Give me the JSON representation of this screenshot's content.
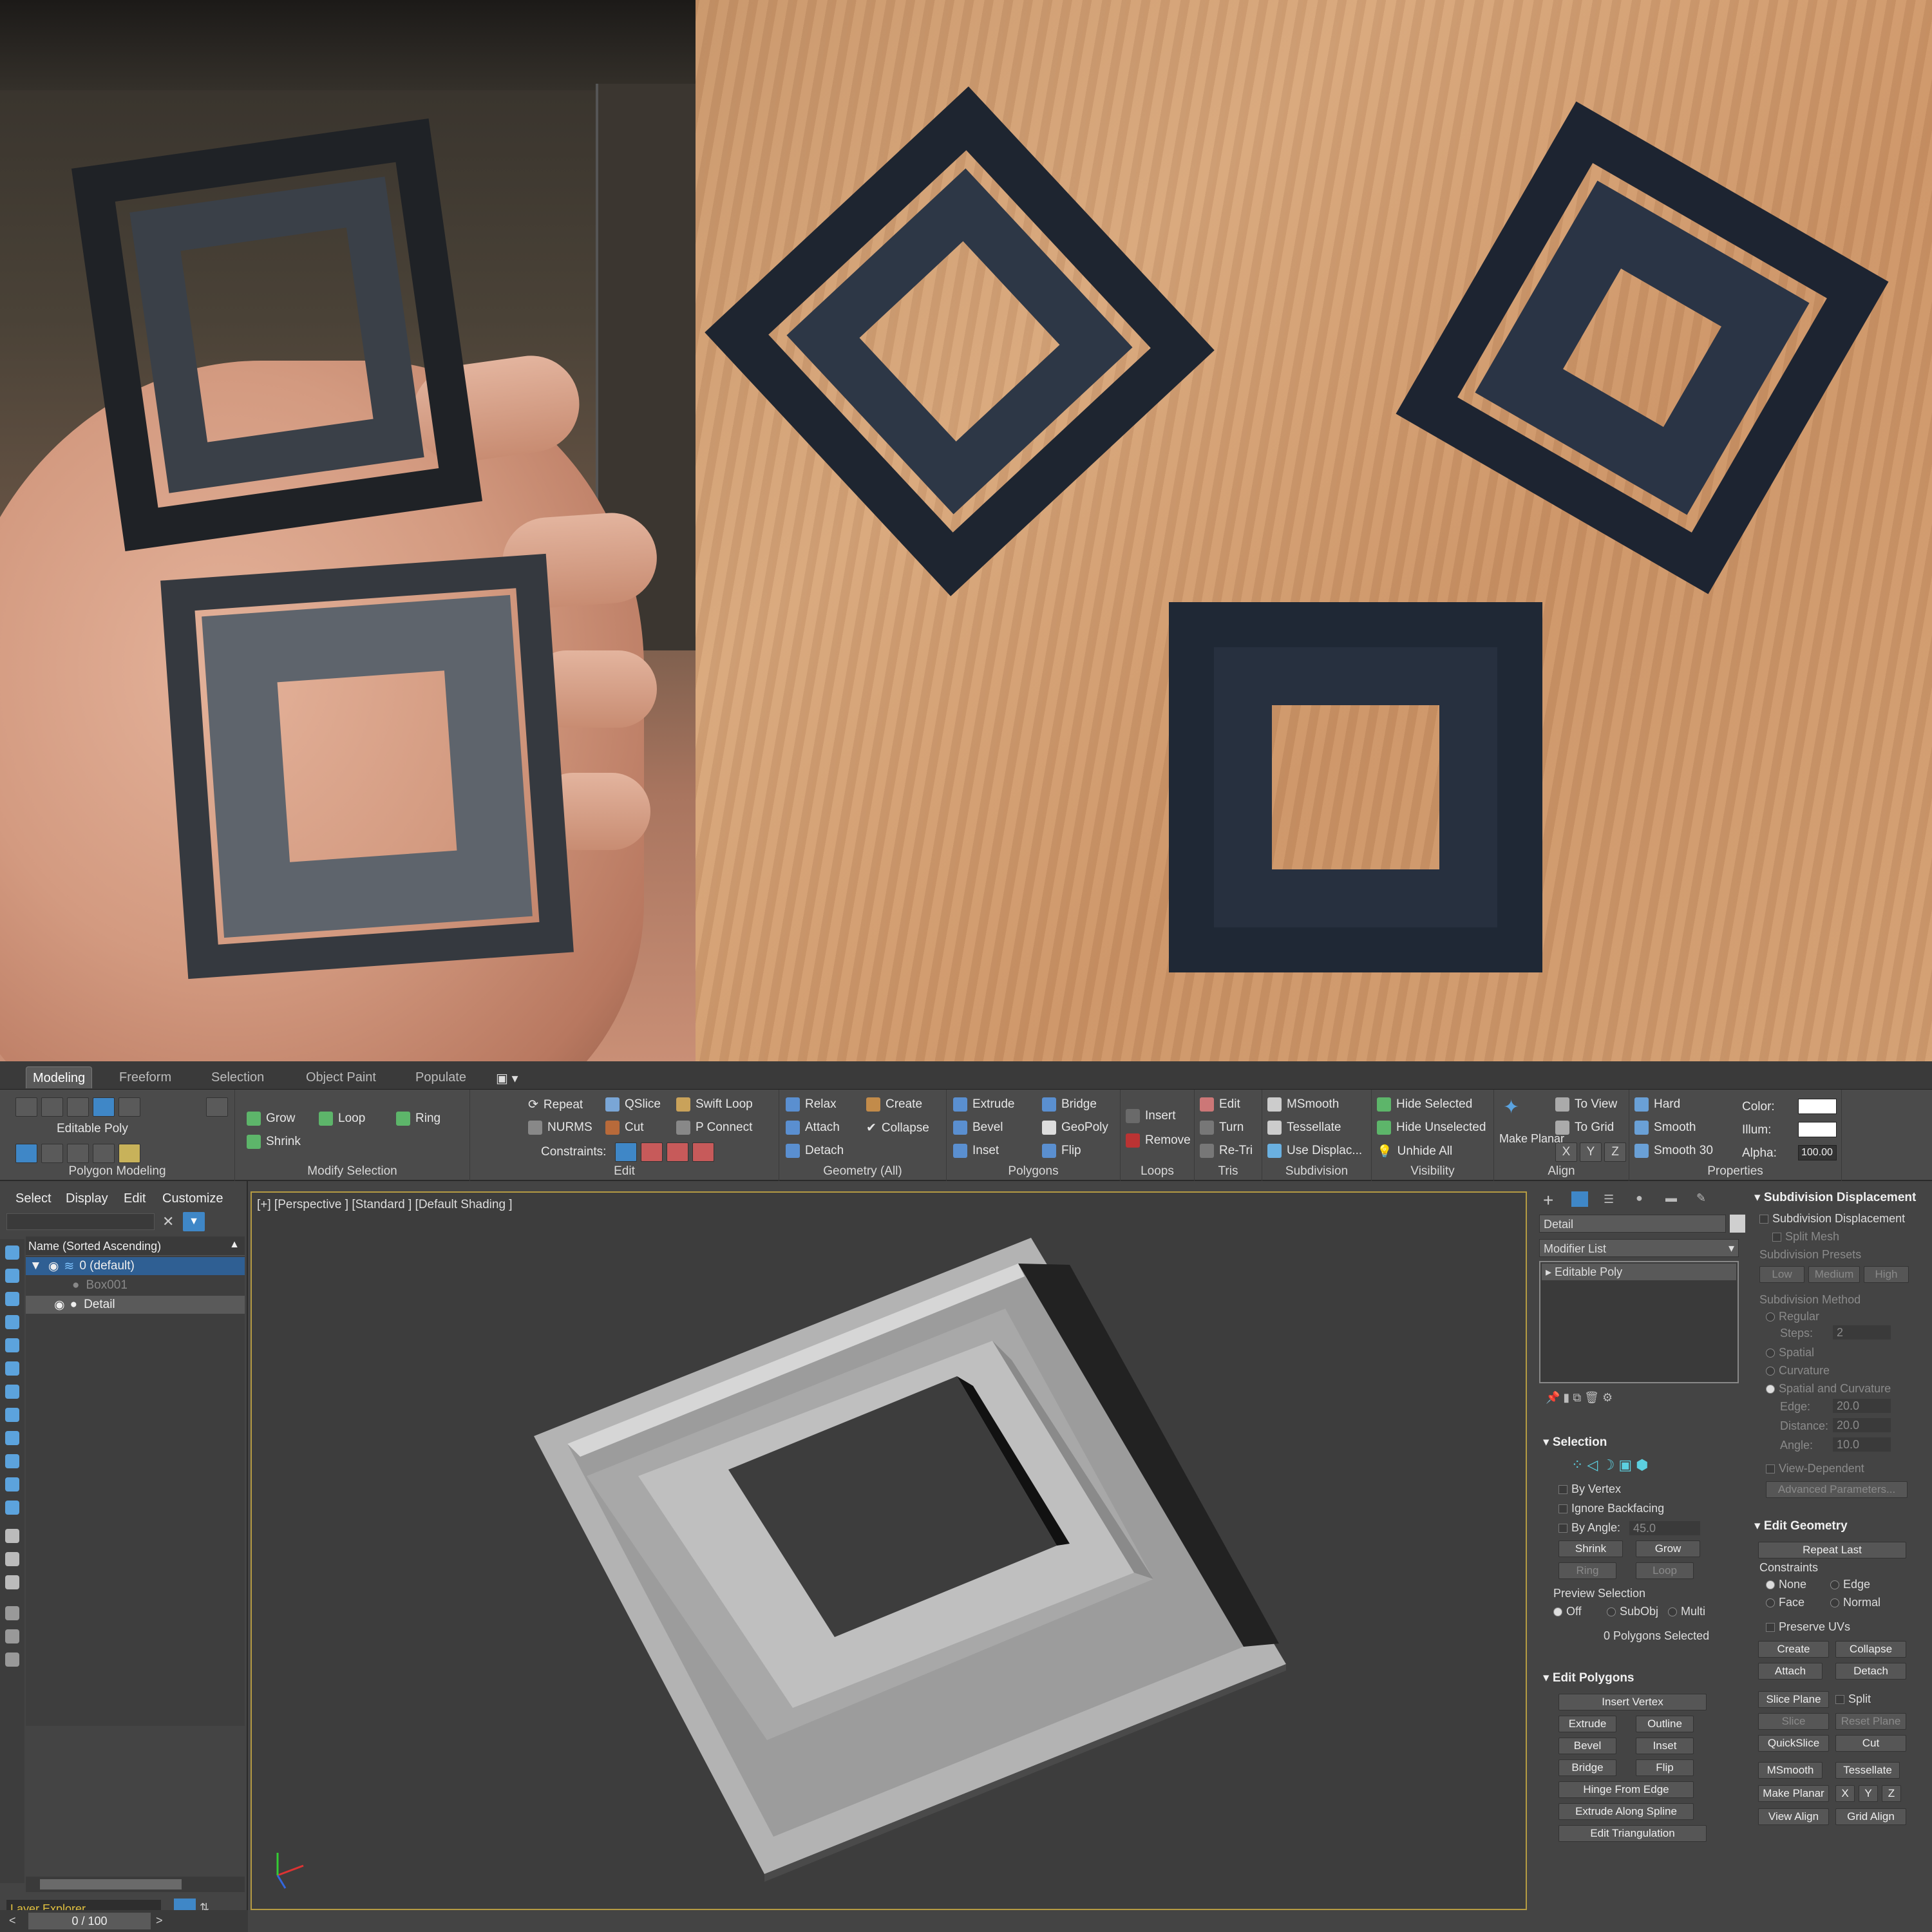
{
  "photo_left": {
    "caption": ""
  },
  "ribbon": {
    "tabs": [
      "Modeling",
      "Freeform",
      "Selection",
      "Object Paint",
      "Populate"
    ],
    "active_tab": "Modeling",
    "groups": {
      "polygon_modeling": {
        "label": "Polygon Modeling",
        "object": "Editable Poly"
      },
      "modify_selection": {
        "label": "Modify Selection",
        "grow": "Grow",
        "shrink": "Shrink",
        "loop": "Loop",
        "ring": "Ring"
      },
      "edit": {
        "label": "Edit",
        "repeat": "Repeat",
        "qslice": "QSlice",
        "swift_loop": "Swift Loop",
        "nurms": "NURMS",
        "cut": "Cut",
        "p_connect": "P Connect",
        "constraints": "Constraints:"
      },
      "geometry": {
        "label": "Geometry (All)",
        "relax": "Relax",
        "create": "Create",
        "attach": "Attach",
        "collapse": "Collapse",
        "detach": "Detach"
      },
      "polygons": {
        "label": "Polygons",
        "extrude": "Extrude",
        "bridge": "Bridge",
        "bevel": "Bevel",
        "geopoly": "GeoPoly",
        "inset": "Inset",
        "flip": "Flip"
      },
      "loops": {
        "label": "Loops",
        "insert": "Insert",
        "remove": "Remove"
      },
      "tris": {
        "label": "Tris",
        "edit": "Edit",
        "turn": "Turn",
        "retri": "Re-Tri"
      },
      "subdivision": {
        "label": "Subdivision",
        "msmooth": "MSmooth",
        "tessellate": "Tessellate",
        "use_displac": "Use Displac..."
      },
      "visibility": {
        "label": "Visibility",
        "hide_selected": "Hide Selected",
        "hide_unselected": "Hide Unselected",
        "unhide_all": "Unhide All"
      },
      "align": {
        "label": "Align",
        "make_planar": "Make Planar",
        "to_view": "To View",
        "to_grid": "To Grid",
        "x": "X",
        "y": "Y",
        "z": "Z"
      },
      "properties": {
        "label": "Properties",
        "hard": "Hard",
        "smooth": "Smooth",
        "smooth30": "Smooth 30",
        "color": "Color:",
        "illum": "Illum:",
        "alpha": "Alpha:",
        "alpha_value": "100.00"
      }
    }
  },
  "scene_explorer": {
    "menu": [
      "Select",
      "Display",
      "Edit",
      "Customize"
    ],
    "column_header": "Name (Sorted Ascending)",
    "rows": [
      "0 (default)",
      "Box001",
      "Detail"
    ],
    "footer": "Layer Explorer",
    "timeline": "0 / 100"
  },
  "viewport": {
    "label": "[+] [Perspective ] [Standard ] [Default Shading ]"
  },
  "command_panel": {
    "object_name": "Detail",
    "modifier_list": "Modifier List",
    "stack_item": "Editable Poly",
    "selection": {
      "title": "Selection",
      "by_vertex": "By Vertex",
      "ignore_backfacing": "Ignore Backfacing",
      "by_angle": "By Angle:",
      "angle_value": "45.0",
      "shrink": "Shrink",
      "grow": "Grow",
      "ring": "Ring",
      "loop": "Loop",
      "preview": "Preview Selection",
      "off": "Off",
      "subobj": "SubObj",
      "multi": "Multi",
      "status": "0 Polygons Selected"
    },
    "edit_polygons": {
      "title": "Edit Polygons",
      "insert_vertex": "Insert Vertex",
      "extrude": "Extrude",
      "outline": "Outline",
      "bevel": "Bevel",
      "inset": "Inset",
      "bridge": "Bridge",
      "flip": "Flip",
      "hinge": "Hinge From Edge",
      "extrude_spline": "Extrude Along Spline",
      "edit_tri": "Edit Triangulation"
    },
    "subdiv": {
      "title": "Subdivision Displacement",
      "subdiv_disp": "Subdivision Displacement",
      "split_mesh": "Split Mesh",
      "presets": "Subdivision Presets",
      "low": "Low",
      "medium": "Medium",
      "high": "High",
      "method": "Subdivision Method",
      "regular": "Regular",
      "steps": "Steps:",
      "steps_value": "2",
      "spatial": "Spatial",
      "curvature": "Curvature",
      "spatial_curv": "Spatial and Curvature",
      "edge": "Edge:",
      "edge_value": "20.0",
      "distance": "Distance:",
      "distance_value": "20.0",
      "angle": "Angle:",
      "angle_value": "10.0",
      "view_dep": "View-Dependent",
      "advanced": "Advanced Parameters..."
    },
    "edit_geometry": {
      "title": "Edit Geometry",
      "repeat_last": "Repeat Last",
      "constraints": "Constraints",
      "none": "None",
      "edge": "Edge",
      "face": "Face",
      "normal": "Normal",
      "preserve_uvs": "Preserve UVs",
      "create": "Create",
      "collapse": "Collapse",
      "attach": "Attach",
      "detach": "Detach",
      "slice_plane": "Slice Plane",
      "split": "Split",
      "slice": "Slice",
      "reset_plane": "Reset Plane",
      "quickslice": "QuickSlice",
      "cut": "Cut",
      "msmooth": "MSmooth",
      "tessellate": "Tessellate",
      "make_planar": "Make Planar",
      "x": "X",
      "y": "Y",
      "z": "Z",
      "view_align": "View Align",
      "grid_align": "Grid Align"
    }
  },
  "colors": {
    "accent": "#3f87c7",
    "viewport_border": "#b59b43",
    "selection_highlight": "#2f5f93"
  }
}
